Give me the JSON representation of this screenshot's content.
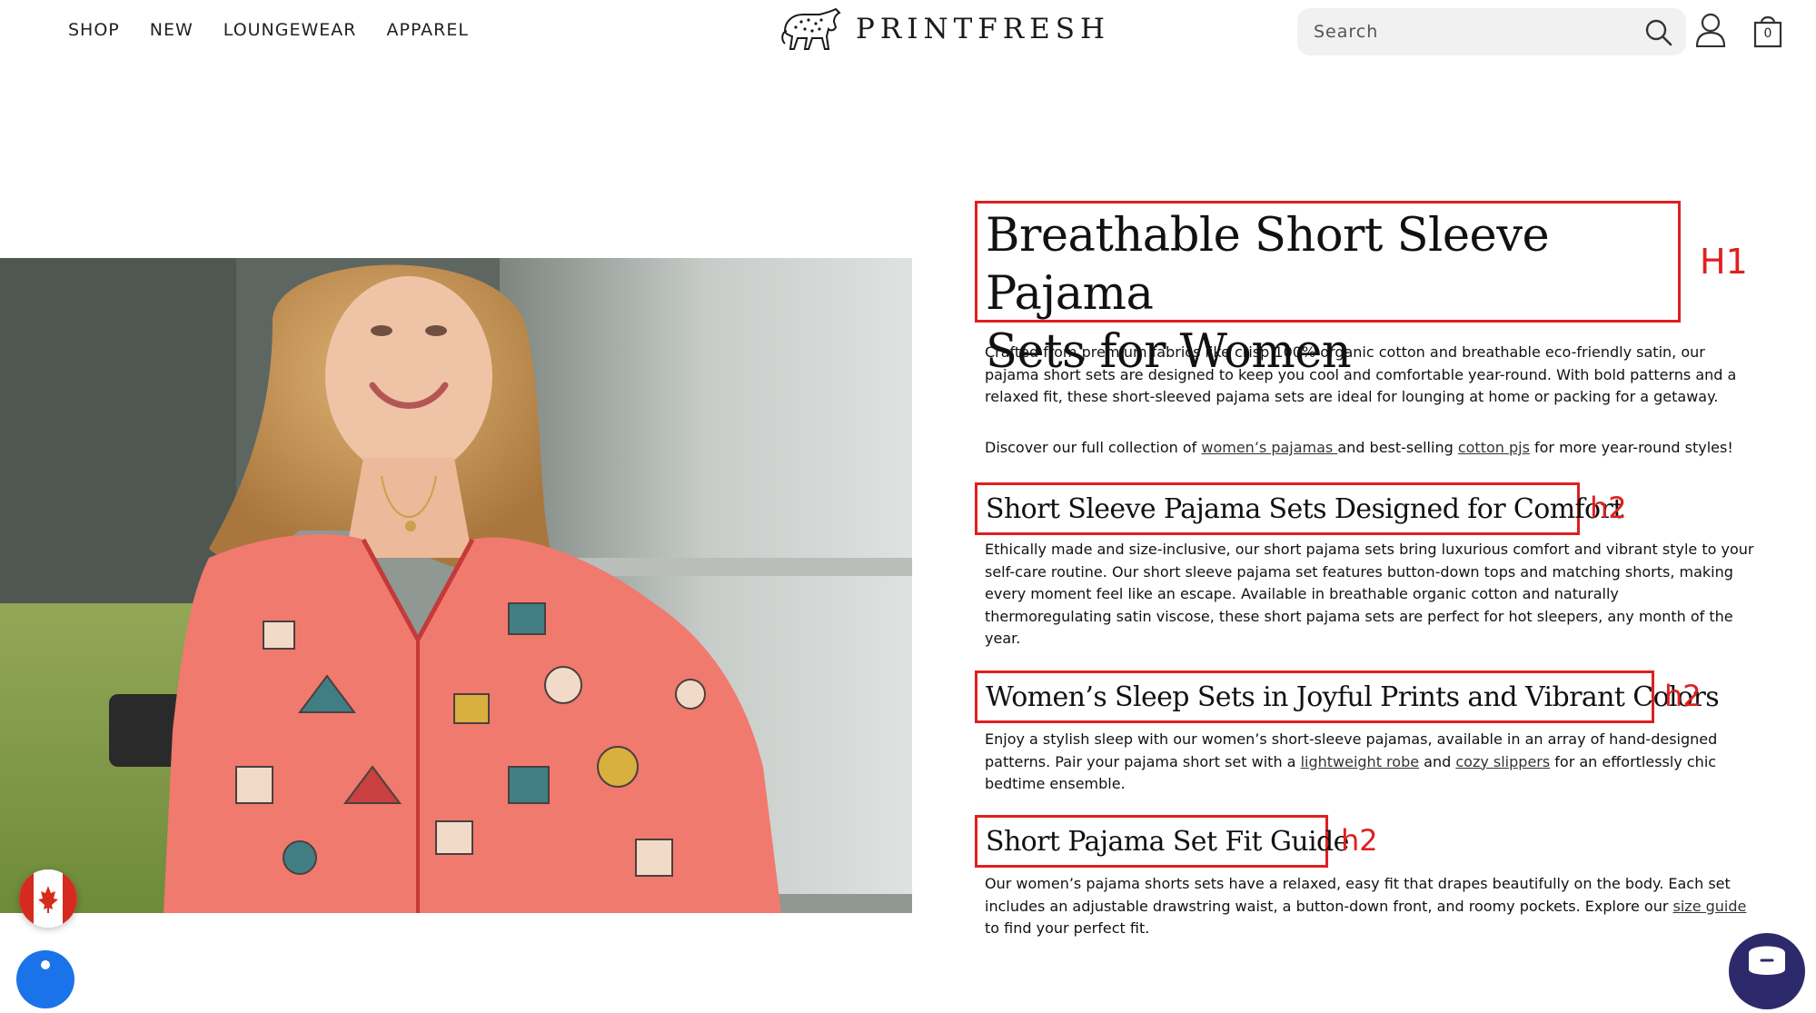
{
  "header": {
    "nav": [
      "SHOP",
      "NEW",
      "LOUNGEWEAR",
      "APPAREL"
    ],
    "logo_text": "PRINTFRESH",
    "search_placeholder": "Search",
    "cart_count": "0"
  },
  "content": {
    "h1": {
      "line1": "Breathable Short Sleeve Pajama",
      "line2": "Sets for Women",
      "tag": "H1"
    },
    "intro": {
      "line1": "Crafted from premium fabrics like crisp 100% organic cotton and breathable eco-friendly satin, our",
      "line2": "pajama short sets are designed to keep you cool and comfortable year-round. With bold patterns and a",
      "line3": "relaxed fit, these short-sleeved pajama sets are ideal for lounging at home or packing for a getaway."
    },
    "discover": {
      "before": "Discover our full collection of ",
      "link1": "women’s pajamas ",
      "middle": "and best-selling ",
      "link2": "cotton pjs",
      "after": " for more year-round styles!"
    },
    "section1": {
      "heading": "Short Sleeve Pajama Sets Designed for Comfort",
      "tag": "h2",
      "line1": "Ethically made and size-inclusive, our short pajama sets bring luxurious comfort and vibrant style to your",
      "line2": "self-care routine. Our short sleeve pajama set features button-down tops and matching shorts, making",
      "line3": "every moment feel like an escape. Available in breathable organic cotton and naturally",
      "line4": "thermoregulating satin viscose, these short pajama sets are perfect for hot sleepers, any month of the",
      "line5": "year."
    },
    "section2": {
      "heading": "Women’s Sleep Sets in Joyful Prints and Vibrant Colors",
      "tag": "h2",
      "line1": "Enjoy a stylish sleep with our women’s short-sleeve pajamas, available in an array of hand-designed",
      "line2_before": "patterns. Pair your pajama short set with a ",
      "line2_link1": "lightweight robe",
      "line2_middle": " and ",
      "line2_link2": "cozy slippers",
      "line2_after": " for an effortlessly chic",
      "line3": "bedtime ensemble."
    },
    "section3": {
      "heading": "Short Pajama Set Fit Guide",
      "tag": "h2",
      "line1": "Our women’s pajama shorts sets have a relaxed, easy fit that drapes beautifully on the body. Each set",
      "line2_before": "includes an adjustable drawstring waist, a button-down front, and roomy pockets. Explore our ",
      "line2_link": "size guide",
      "line3": "to find your perfect fit."
    }
  },
  "colors": {
    "annotation_red": "#e01f1f",
    "search_bg": "#f1f1f1",
    "chat_bg": "#2d2a6b",
    "accessibility_bg": "#1a73e8"
  }
}
